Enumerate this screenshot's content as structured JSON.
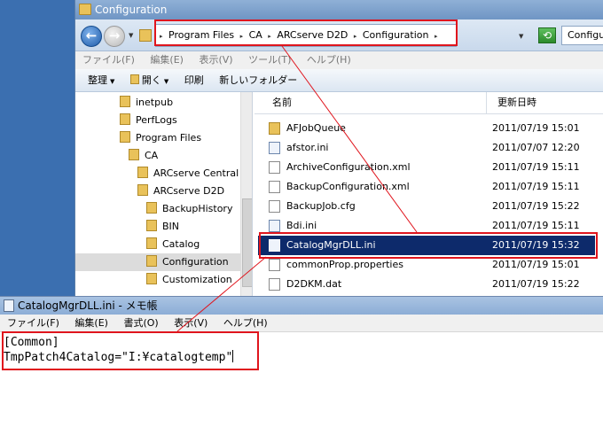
{
  "explorer": {
    "title": "Configuration",
    "breadcrumb": [
      "Program Files",
      "CA",
      "ARCserve D2D",
      "Configuration"
    ],
    "search_value": "Configur",
    "menu": [
      "ファイル(F)",
      "編集(E)",
      "表示(V)",
      "ツール(T)",
      "ヘルプ(H)"
    ],
    "commands": {
      "organize": "整理",
      "open": "開く",
      "print": "印刷",
      "new_folder": "新しいフォルダー"
    },
    "tree": [
      {
        "label": "inetpub"
      },
      {
        "label": "PerfLogs"
      },
      {
        "label": "Program Files"
      },
      {
        "label": "CA"
      },
      {
        "label": "ARCserve Central"
      },
      {
        "label": "ARCserve D2D"
      },
      {
        "label": "BackupHistory"
      },
      {
        "label": "BIN"
      },
      {
        "label": "Catalog"
      },
      {
        "label": "Configuration"
      },
      {
        "label": "Customization"
      }
    ],
    "columns": {
      "name": "名前",
      "date": "更新日時"
    },
    "files": [
      {
        "name": "AFJobQueue",
        "date": "2011/07/19 15:01",
        "kind": "folder"
      },
      {
        "name": "afstor.ini",
        "date": "2011/07/07 12:20",
        "kind": "cfg"
      },
      {
        "name": "ArchiveConfiguration.xml",
        "date": "2011/07/19 15:11",
        "kind": "file"
      },
      {
        "name": "BackupConfiguration.xml",
        "date": "2011/07/19 15:11",
        "kind": "file"
      },
      {
        "name": "BackupJob.cfg",
        "date": "2011/07/19 15:22",
        "kind": "file"
      },
      {
        "name": "Bdi.ini",
        "date": "2011/07/19 15:11",
        "kind": "cfg"
      },
      {
        "name": "CatalogMgrDLL.ini",
        "date": "2011/07/19 15:32",
        "kind": "cfg"
      },
      {
        "name": "commonProp.properties",
        "date": "2011/07/19 15:01",
        "kind": "file"
      },
      {
        "name": "D2DKM.dat",
        "date": "2011/07/19 15:22",
        "kind": "file"
      }
    ]
  },
  "notepad": {
    "title": "CatalogMgrDLL.ini - メモ帳",
    "menu": [
      "ファイル(F)",
      "編集(E)",
      "書式(O)",
      "表示(V)",
      "ヘルプ(H)"
    ],
    "line1": "[Common]",
    "line2": "TmpPatch4Catalog=\"I:¥catalogtemp\""
  },
  "colors": {
    "highlight": "#e0151d",
    "selection": "#0d2a6b"
  }
}
